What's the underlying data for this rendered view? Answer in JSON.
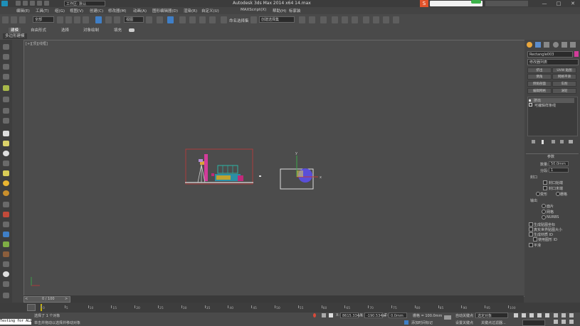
{
  "window": {
    "title": "Autodesk 3ds Max  2014 x64      14.max",
    "workspace": "工作区: 默认"
  },
  "menu": [
    "编辑(E)",
    "工具(T)",
    "组(G)",
    "视图(V)",
    "创建(C)",
    "修改器(M)",
    "动画(A)",
    "图形编辑器(D)",
    "渲染(R)",
    "自定义(U)",
    "MAXScript(X)",
    "帮助(H)",
    "标家装"
  ],
  "toolbar": {
    "selection_filter": "全部",
    "ref_coord": "视图",
    "named_sel": "创建选择集",
    "snap_percent": "2.5"
  },
  "ribbon": {
    "tabs": [
      "建模",
      "自由形式",
      "选择",
      "对象绘制",
      "填充"
    ],
    "active": "建模",
    "sub": "多边形建模"
  },
  "viewport": {
    "label": "[+][顶][线框]"
  },
  "right_panel": {
    "object_name": "Rectangle003",
    "modifier_list": "修改器列表",
    "mod_buttons": [
      "挤出",
      "UVW 贴图",
      "倒角",
      "网格平滑",
      "倒角剖面",
      "车削",
      "编辑网格",
      "涡轮"
    ],
    "stack": [
      "挤出",
      "可编辑样条线"
    ],
    "params_title": "参数",
    "amount_label": "数量:",
    "amount_value": "50.0mm",
    "segments_label": "分段:",
    "segments_value": "1",
    "capping_title": "封口",
    "cap_start": "封口始端",
    "cap_end": "封口末端",
    "morph": "变形",
    "grid": "栅格",
    "output_title": "输出",
    "out_patch": "面片",
    "out_mesh": "网格",
    "out_nurbs": "NURBS",
    "gen_map": "生成贴图坐标",
    "real_world": "真实世界贴图大小",
    "gen_matid": "生成材质 ID",
    "use_shape_ids": "使用图形 ID",
    "smooth": "平滑"
  },
  "timeline": {
    "frame": "0 / 100"
  },
  "track_numbers": [
    "0",
    "5",
    "10",
    "15",
    "20",
    "25",
    "30",
    "35",
    "40",
    "45",
    "50",
    "55",
    "60",
    "65",
    "70",
    "75",
    "80",
    "85",
    "90",
    "95",
    "100"
  ],
  "status": {
    "left_label": "Testing for ALL",
    "line1": "选择了 1 个对象",
    "line2": "单击并拖动以选择并移动对象",
    "x_label": "X:",
    "x_val": "8615.334m",
    "y_label": "Y:",
    "y_val": "-190.534m",
    "z_label": "Z:",
    "z_val": "0.0mm",
    "grid": "栅格 = 100.0mm",
    "add_time_tag": "添加时间标记",
    "auto_key": "自动关键点",
    "set_key": "设置关键点",
    "key_filters": "关键点过滤器...",
    "sel_set": "选定对象"
  },
  "colors": {
    "accent": "#c23a3a",
    "purple": "#5a4fd8",
    "bg_viewport": "#4c4c4c"
  }
}
